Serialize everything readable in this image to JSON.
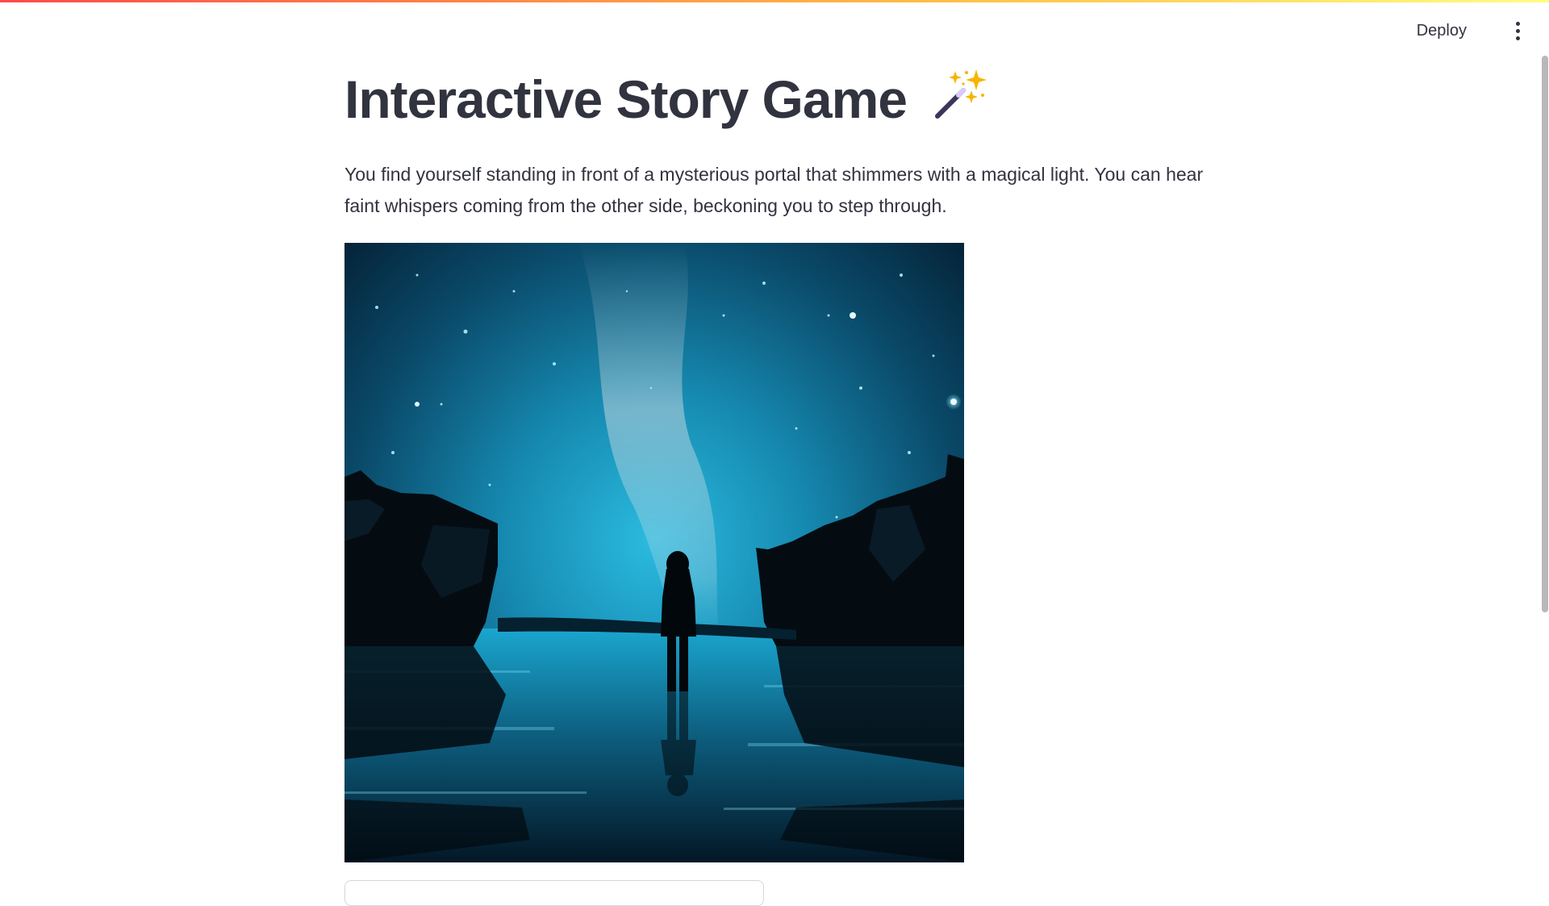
{
  "header": {
    "deploy_label": "Deploy",
    "menu_icon": "more-vertical-icon"
  },
  "main": {
    "title": "Interactive Story Game",
    "title_icon": "magic-wand-icon",
    "story_text": "You find yourself standing in front of a mysterious portal that shimmers with a magical light. You can hear faint whispers coming from the other side, beckoning you to step through.",
    "scene_image": "scene-image"
  },
  "colors": {
    "accent_gradient_start": "#ff4b4b",
    "accent_gradient_end": "#fffd80",
    "text": "#31333f",
    "scene_teal": "#1fb3d8"
  }
}
